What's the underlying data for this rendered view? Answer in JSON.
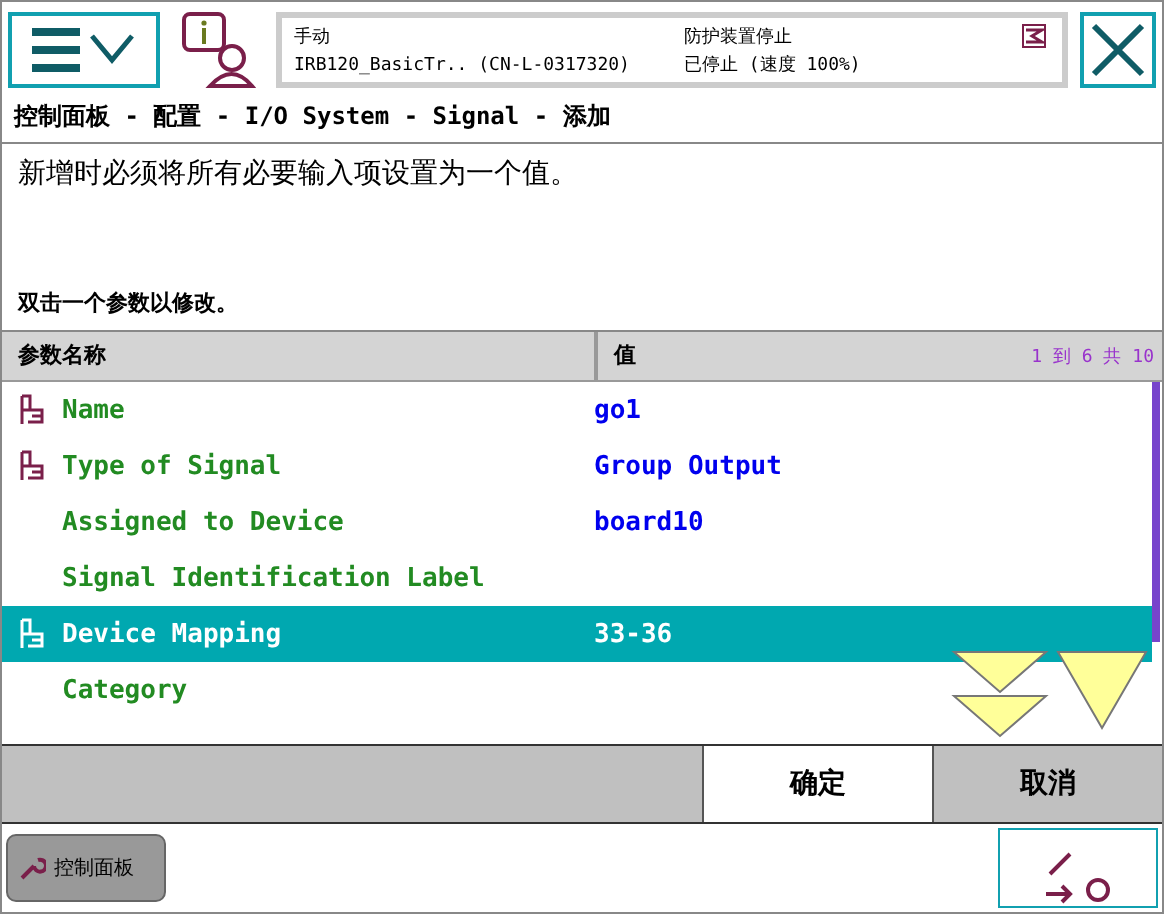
{
  "header": {
    "mode": "手动",
    "robot": "IRB120_BasicTr..  (CN-L-0317320)",
    "safety": "防护装置停止",
    "state": "已停止 (速度 100%)"
  },
  "breadcrumb": "控制面板 - 配置 - I/O System - Signal - 添加",
  "message": "新增时必须将所有必要输入项设置为一个值。",
  "hint": "双击一个参数以修改。",
  "table": {
    "columns": [
      "参数名称",
      "值"
    ],
    "range": "1 到 6 共 10",
    "rows": [
      {
        "name": "Name",
        "value": "go1",
        "required": true,
        "selected": false
      },
      {
        "name": "Type of Signal",
        "value": "Group Output",
        "required": true,
        "selected": false
      },
      {
        "name": "Assigned to Device",
        "value": "board10",
        "required": false,
        "selected": false
      },
      {
        "name": "Signal Identification Label",
        "value": "",
        "required": false,
        "selected": false
      },
      {
        "name": "Device Mapping",
        "value": "33-36",
        "required": true,
        "selected": true
      },
      {
        "name": "Category",
        "value": "",
        "required": false,
        "selected": false
      }
    ]
  },
  "buttons": [
    "确定",
    "取消"
  ],
  "taskbar": {
    "item": "控制面板"
  }
}
